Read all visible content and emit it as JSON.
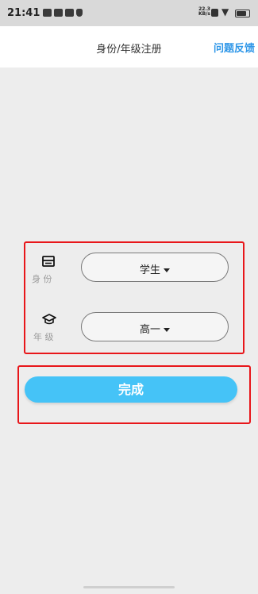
{
  "status_bar": {
    "time": "21:41",
    "net_speed_value": "22.3",
    "net_speed_unit": "KB/s"
  },
  "header": {
    "title": "身份/年级注册",
    "feedback_label": "问题反馈"
  },
  "form": {
    "identity": {
      "label": "身 份",
      "icon": "id-card-icon",
      "value": "学生"
    },
    "grade": {
      "label": "年 级",
      "icon": "graduation-cap-icon",
      "value": "高一"
    }
  },
  "actions": {
    "done_label": "完成"
  },
  "colors": {
    "accent": "#45c3f7",
    "link": "#2f97e8",
    "highlight": "#e8161a"
  }
}
